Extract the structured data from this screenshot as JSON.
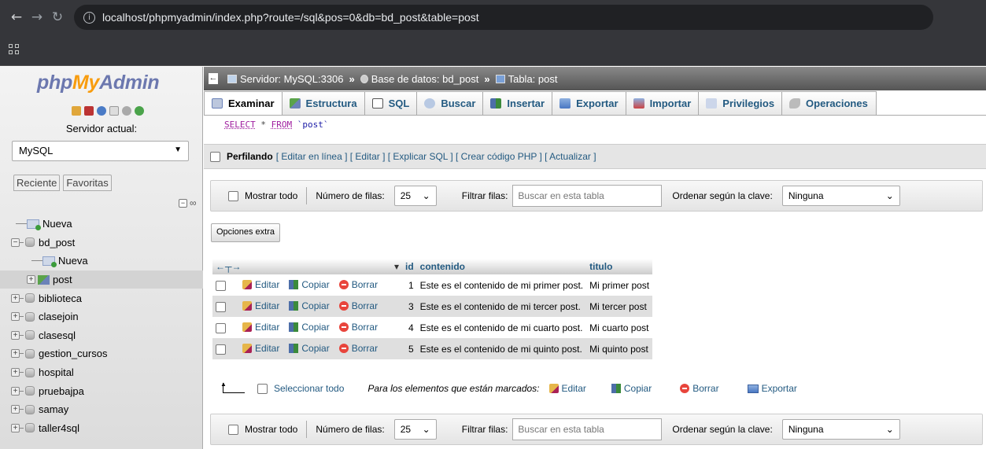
{
  "browser": {
    "url": "localhost/phpmyadmin/index.php?route=/sql&pos=0&db=bd_post&table=post",
    "back_icon": "arrow-left-icon",
    "forward_icon": "arrow-right-icon",
    "reload_icon": "reload-icon"
  },
  "sidebar": {
    "logo": {
      "php": "php",
      "my": "My",
      "admin": "Admin"
    },
    "server_label": "Servidor actual:",
    "server_value": "MySQL",
    "tab_recent": "Reciente",
    "tab_favorites": "Favoritas",
    "tree": [
      {
        "label": "Nueva",
        "type": "new",
        "indent": 0
      },
      {
        "label": "bd_post",
        "type": "db",
        "indent": 0,
        "expanded": true
      },
      {
        "label": "Nueva",
        "type": "new",
        "indent": 1
      },
      {
        "label": "post",
        "type": "table",
        "indent": 1
      },
      {
        "label": "biblioteca",
        "type": "db",
        "indent": 0
      },
      {
        "label": "clasejoin",
        "type": "db",
        "indent": 0
      },
      {
        "label": "clasesql",
        "type": "db",
        "indent": 0
      },
      {
        "label": "gestion_cursos",
        "type": "db",
        "indent": 0
      },
      {
        "label": "hospital",
        "type": "db",
        "indent": 0
      },
      {
        "label": "pruebajpa",
        "type": "db",
        "indent": 0
      },
      {
        "label": "samay",
        "type": "db",
        "indent": 0
      },
      {
        "label": "taller4sql",
        "type": "db",
        "indent": 0
      }
    ]
  },
  "breadcrumb": {
    "server": "Servidor: MySQL:3306",
    "database": "Base de datos: bd_post",
    "table": "Tabla: post",
    "separator": "»"
  },
  "tabs": [
    "Examinar",
    "Estructura",
    "SQL",
    "Buscar",
    "Insertar",
    "Exportar",
    "Importar",
    "Privilegios",
    "Operaciones"
  ],
  "sql": {
    "select": "SELECT",
    "star": "*",
    "from": "FROM",
    "table": "`post`"
  },
  "profiling": {
    "label": "Perfilando",
    "links": "[ Editar en línea ] [ Editar ] [ Explicar SQL ] [ Crear código PHP ] [ Actualizar ]"
  },
  "navbar": {
    "show_all": "Mostrar todo",
    "rows_label": "Número de filas:",
    "rows_value": "25",
    "filter_label": "Filtrar filas:",
    "filter_placeholder": "Buscar en esta tabla",
    "sort_label": "Ordenar según la clave:",
    "sort_value": "Ninguna"
  },
  "extra_options": "Opciones extra",
  "table": {
    "sort_arrow": "▾",
    "headers": [
      "id",
      "contenido",
      "titulo"
    ],
    "action_edit": "Editar",
    "action_copy": "Copiar",
    "action_delete": "Borrar",
    "rows": [
      {
        "id": "1",
        "contenido": "Este es el contenido de mi primer post.",
        "titulo": "Mi primer post"
      },
      {
        "id": "3",
        "contenido": "Este es el contenido de mi tercer post.",
        "titulo": "Mi tercer post"
      },
      {
        "id": "4",
        "contenido": "Este es el contenido de mi cuarto post.",
        "titulo": "Mi cuarto post"
      },
      {
        "id": "5",
        "contenido": "Este es el contenido de mi quinto post.",
        "titulo": "Mi quinto post"
      }
    ]
  },
  "bulk": {
    "select_all": "Seleccionar todo",
    "marked_label": "Para los elementos que están marcados:",
    "edit": "Editar",
    "copy": "Copiar",
    "delete": "Borrar",
    "export": "Exportar"
  }
}
